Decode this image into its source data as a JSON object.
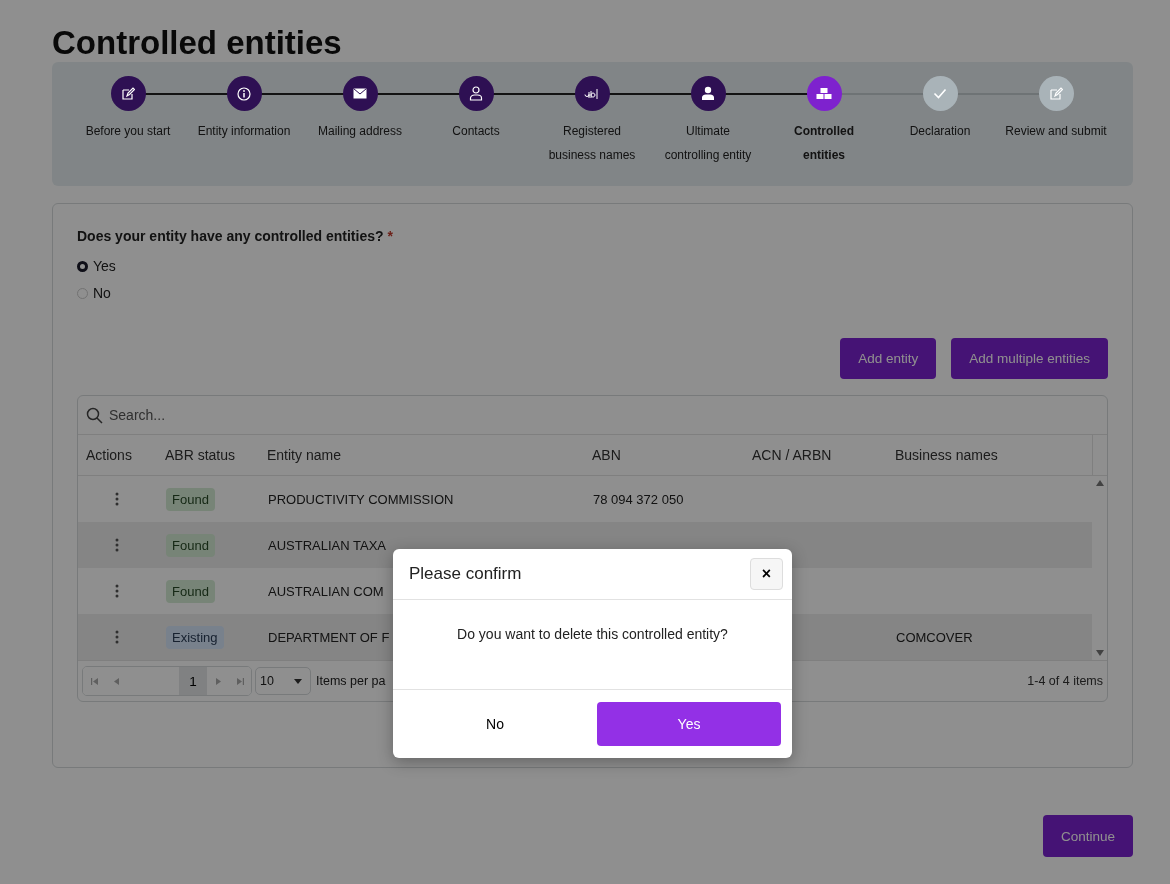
{
  "title": "Controlled entities",
  "steps": [
    {
      "label": "Before you start",
      "kind": "done"
    },
    {
      "label": "Entity information",
      "kind": "done"
    },
    {
      "label": "Mailing address",
      "kind": "done"
    },
    {
      "label": "Contacts",
      "kind": "done"
    },
    {
      "label": "Registered business names",
      "kind": "done"
    },
    {
      "label": "Ultimate controlling entity",
      "kind": "done"
    },
    {
      "label": "Controlled entities",
      "kind": "current"
    },
    {
      "label": "Declaration",
      "kind": "upcoming"
    },
    {
      "label": "Review and submit",
      "kind": "upcoming"
    }
  ],
  "question": {
    "label": "Does your entity have any controlled entities?",
    "required": "*",
    "options": [
      {
        "label": "Yes",
        "selected": true
      },
      {
        "label": "No",
        "selected": false
      }
    ]
  },
  "actions": [
    "Add entity",
    "Add multiple entities"
  ],
  "table": {
    "search_placeholder": "Search...",
    "columns": [
      "Actions",
      "ABR status",
      "Entity name",
      "ABN",
      "ACN / ARBN",
      "Business names"
    ],
    "rows": [
      {
        "status": {
          "label": "Found",
          "kind": "found"
        },
        "entity_name": "PRODUCTIVITY COMMISSION",
        "abn": "78 094 372 050"
      },
      {
        "status": {
          "label": "Found",
          "kind": "found"
        },
        "entity_name": "AUSTRALIAN TAXA"
      },
      {
        "status": {
          "label": "Found",
          "kind": "found"
        },
        "entity_name": "AUSTRALIAN COM"
      },
      {
        "status": {
          "label": "Existing",
          "kind": "existing"
        },
        "entity_name": "DEPARTMENT OF F",
        "business_names": "COMCOVER"
      }
    ],
    "pager": {
      "page": "1",
      "page_size": "10",
      "page_size_label": "Items per pa",
      "summary": "1-4 of 4 items"
    }
  },
  "continue": "Continue",
  "modal": {
    "title": "Please confirm",
    "close": "×",
    "message": "Do you want to delete this controlled entity?",
    "buttons": [
      {
        "label": "No",
        "kind": "secondary"
      },
      {
        "label": "Yes",
        "kind": "primary"
      }
    ]
  }
}
